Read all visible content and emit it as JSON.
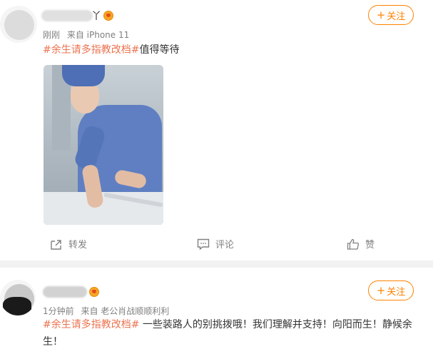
{
  "posts": [
    {
      "name_visible": "丫",
      "time": "刚刚",
      "source": "来自 iPhone 11",
      "follow_label": "关注",
      "follow_plus": "+",
      "hashtag": "#余生请多指教改档#",
      "text": "值得等待",
      "actions": {
        "share": "转发",
        "comment": "评论",
        "like": "赞"
      }
    },
    {
      "time": "1分钟前",
      "source": "来自 老公肖战顺顺利利",
      "follow_label": "关注",
      "follow_plus": "+",
      "hashtag": "#余生请多指教改档#",
      "text": " 一些装路人的别挑拨哦！我们理解并支持！向阳而生！静候余生！"
    }
  ],
  "colors": {
    "accent": "#ff8200",
    "hashtag": "#eb7350",
    "meta": "#808080",
    "separator": "#f2f2f2"
  },
  "icons": {
    "share": "share-icon",
    "comment": "comment-icon",
    "like": "thumbs-up-icon",
    "vip": "crown-badge-icon"
  }
}
